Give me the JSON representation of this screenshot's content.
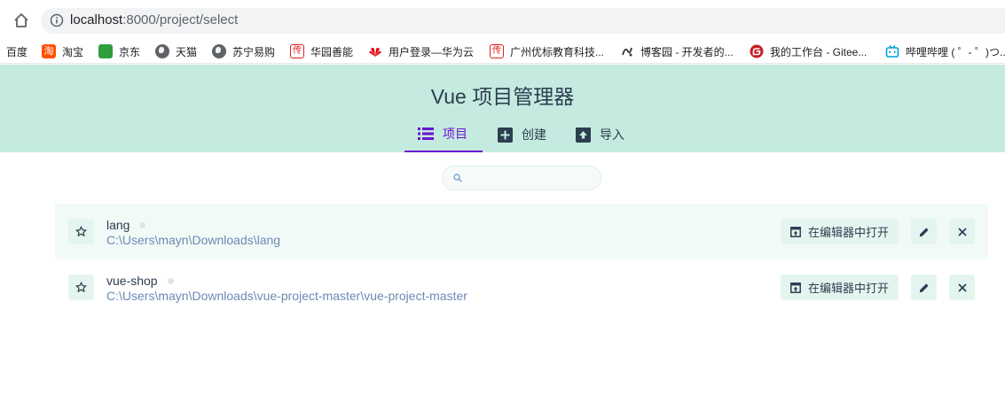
{
  "browser": {
    "url_host": "localhost",
    "url_rest": ":8000/project/select",
    "bookmarks": [
      {
        "label": "百度",
        "icon": "none"
      },
      {
        "label": "淘宝",
        "icon": "taobao-icon",
        "color": "#ff5000"
      },
      {
        "label": "京东",
        "icon": "jd-icon",
        "color": "#2e9e3c"
      },
      {
        "label": "天猫",
        "icon": "globe-icon"
      },
      {
        "label": "苏宁易购",
        "icon": "globe-icon"
      },
      {
        "label": "华园善能",
        "icon": "chuan-icon",
        "color": "#e02020"
      },
      {
        "label": "用户登录—华为云",
        "icon": "huawei-icon",
        "color": "#e60012"
      },
      {
        "label": "广州优标教育科技...",
        "icon": "chuan-icon",
        "color": "#e02020"
      },
      {
        "label": "博客园 - 开发者的...",
        "icon": "cnblogs-icon"
      },
      {
        "label": "我的工作台 - Gitee...",
        "icon": "gitee-icon",
        "color": "#c71d23"
      },
      {
        "label": "哔哩哔哩 ( ゜- ゜)つ...",
        "icon": "bilibili-icon",
        "color": "#00a1d6"
      }
    ]
  },
  "app": {
    "title": "Vue 项目管理器",
    "tabs": [
      {
        "label": "项目",
        "icon": "list-icon",
        "active": true
      },
      {
        "label": "创建",
        "icon": "add-icon",
        "active": false
      },
      {
        "label": "导入",
        "icon": "import-icon",
        "active": false
      }
    ],
    "accent_color": "#6a14d1",
    "header_bg": "#c5eadf"
  },
  "search": {
    "placeholder": "",
    "value": ""
  },
  "projects": [
    {
      "name": "lang",
      "path": "C:\\Users\\mayn\\Downloads\\lang",
      "open_label": "在编辑器中打开",
      "highlighted": true
    },
    {
      "name": "vue-shop",
      "path": "C:\\Users\\mayn\\Downloads\\vue-project-master\\vue-project-master",
      "open_label": "在编辑器中打开",
      "highlighted": false
    }
  ]
}
